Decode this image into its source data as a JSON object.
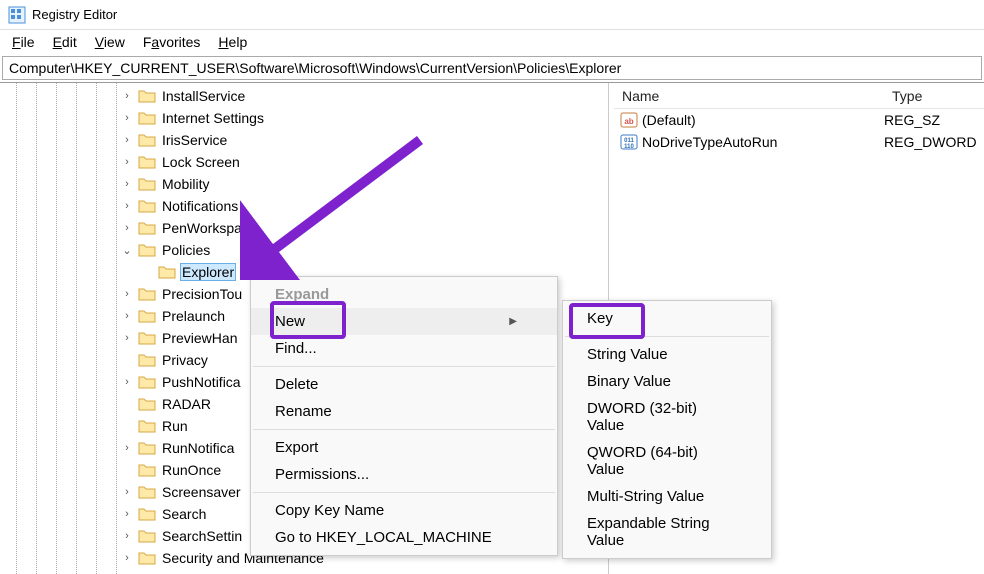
{
  "window": {
    "title": "Registry Editor"
  },
  "menubar": [
    {
      "label": "File",
      "accel": "F"
    },
    {
      "label": "Edit",
      "accel": "E"
    },
    {
      "label": "View",
      "accel": "V"
    },
    {
      "label": "Favorites",
      "accel": "a"
    },
    {
      "label": "Help",
      "accel": "H"
    }
  ],
  "addressbar": "Computer\\HKEY_CURRENT_USER\\Software\\Microsoft\\Windows\\CurrentVersion\\Policies\\Explorer",
  "tree": {
    "items": [
      {
        "label": "InstallService",
        "toggle": ">"
      },
      {
        "label": "Internet Settings",
        "toggle": ">"
      },
      {
        "label": "IrisService",
        "toggle": ">"
      },
      {
        "label": "Lock Screen",
        "toggle": ">"
      },
      {
        "label": "Mobility",
        "toggle": ">"
      },
      {
        "label": "Notifications",
        "toggle": ">"
      },
      {
        "label": "PenWorkspace",
        "toggle": ">"
      },
      {
        "label": "Policies",
        "toggle": "v",
        "expanded": true,
        "children": [
          {
            "label": "Explorer",
            "selected": true
          }
        ]
      },
      {
        "label": "PrecisionTou",
        "toggle": ">"
      },
      {
        "label": "Prelaunch",
        "toggle": ">"
      },
      {
        "label": "PreviewHan",
        "toggle": ">"
      },
      {
        "label": "Privacy",
        "toggle": ""
      },
      {
        "label": "PushNotifica",
        "toggle": ">"
      },
      {
        "label": "RADAR",
        "toggle": ""
      },
      {
        "label": "Run",
        "toggle": ""
      },
      {
        "label": "RunNotifica",
        "toggle": ">"
      },
      {
        "label": "RunOnce",
        "toggle": ""
      },
      {
        "label": "Screensaver",
        "toggle": ">"
      },
      {
        "label": "Search",
        "toggle": ">"
      },
      {
        "label": "SearchSettin",
        "toggle": ">"
      },
      {
        "label": "Security and Maintenance",
        "toggle": ">"
      }
    ]
  },
  "listpane": {
    "columns": {
      "name": "Name",
      "type": "Type"
    },
    "rows": [
      {
        "name": "(Default)",
        "type": "REG_SZ",
        "kind": "sz"
      },
      {
        "name": "NoDriveTypeAutoRun",
        "type": "REG_DWORD",
        "kind": "dw"
      }
    ]
  },
  "context_menu": {
    "items": [
      {
        "label": "Expand",
        "disabled": true
      },
      {
        "label": "New",
        "submenu": true,
        "hover": true
      },
      {
        "label": "Find..."
      },
      {
        "sep": true
      },
      {
        "label": "Delete"
      },
      {
        "label": "Rename"
      },
      {
        "sep": true
      },
      {
        "label": "Export"
      },
      {
        "label": "Permissions..."
      },
      {
        "sep": true
      },
      {
        "label": "Copy Key Name"
      },
      {
        "label": "Go to HKEY_LOCAL_MACHINE"
      }
    ]
  },
  "submenu": {
    "items": [
      {
        "label": "Key",
        "highlight": true
      },
      {
        "sep": true
      },
      {
        "label": "String Value"
      },
      {
        "label": "Binary Value"
      },
      {
        "label": "DWORD (32-bit) Value"
      },
      {
        "label": "QWORD (64-bit) Value"
      },
      {
        "label": "Multi-String Value"
      },
      {
        "label": "Expandable String Value"
      }
    ]
  }
}
